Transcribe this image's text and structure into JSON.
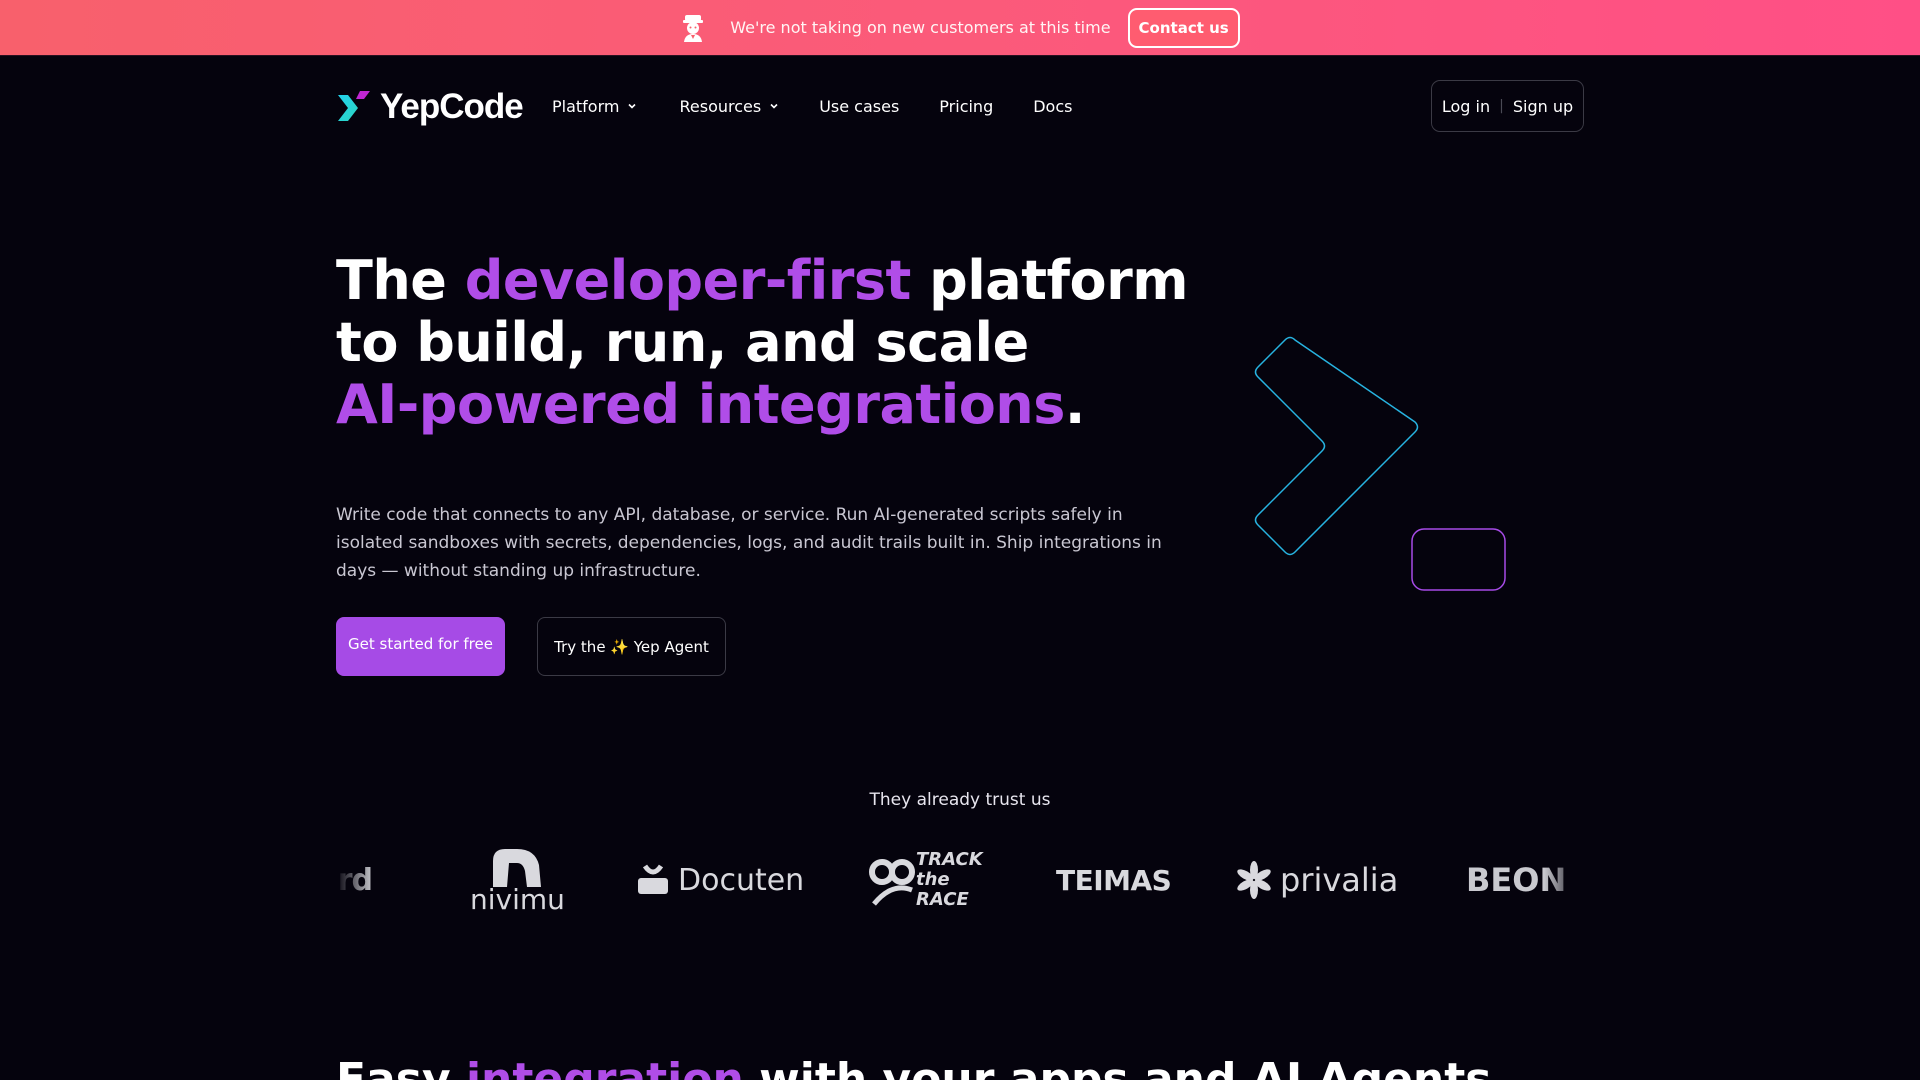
{
  "banner": {
    "message": "We're not taking on new customers at this time",
    "contact_label": "Contact us",
    "icon": "mascot-icon"
  },
  "nav": {
    "brand": "YepCode",
    "items": [
      {
        "label": "Platform",
        "dropdown": true
      },
      {
        "label": "Resources",
        "dropdown": true
      },
      {
        "label": "Use cases",
        "dropdown": false
      },
      {
        "label": "Pricing",
        "dropdown": false
      },
      {
        "label": "Docs",
        "dropdown": false
      }
    ],
    "login_label": "Log in",
    "separator": "|",
    "signup_label": "Sign up"
  },
  "hero": {
    "title": {
      "part1": "The ",
      "accent1": "developer-first",
      "part2": " platform to build, run, and scale",
      "accent2": "AI-powered integrations",
      "part3": "."
    },
    "description": "Write code that connects to any API, database, or service. Run AI-generated scripts safely in isolated sandboxes with secrets, dependencies, logs, and audit trails built in. Ship integrations in days — without standing up infrastructure.",
    "primary_cta": "Get started for free",
    "secondary_cta": "Try the ✨ Yep Agent"
  },
  "trust": {
    "title": "They already trust us",
    "logos": [
      "bird",
      "nivimu",
      "Docuten",
      "TRACK the RACE",
      "TEIMAS",
      "privalia",
      "BEON"
    ]
  },
  "next_section": {
    "part1": "Easy ",
    "accent": "integration",
    "part2": " with your apps and AI Agents"
  },
  "colors": {
    "background": "#05030d",
    "accent": "#b04de8",
    "button_primary": "#a64be6",
    "banner_start": "#f8606c",
    "banner_end": "#ff4f86",
    "graphic_cyan": "#27b3e0",
    "graphic_purple": "#a64be6"
  }
}
